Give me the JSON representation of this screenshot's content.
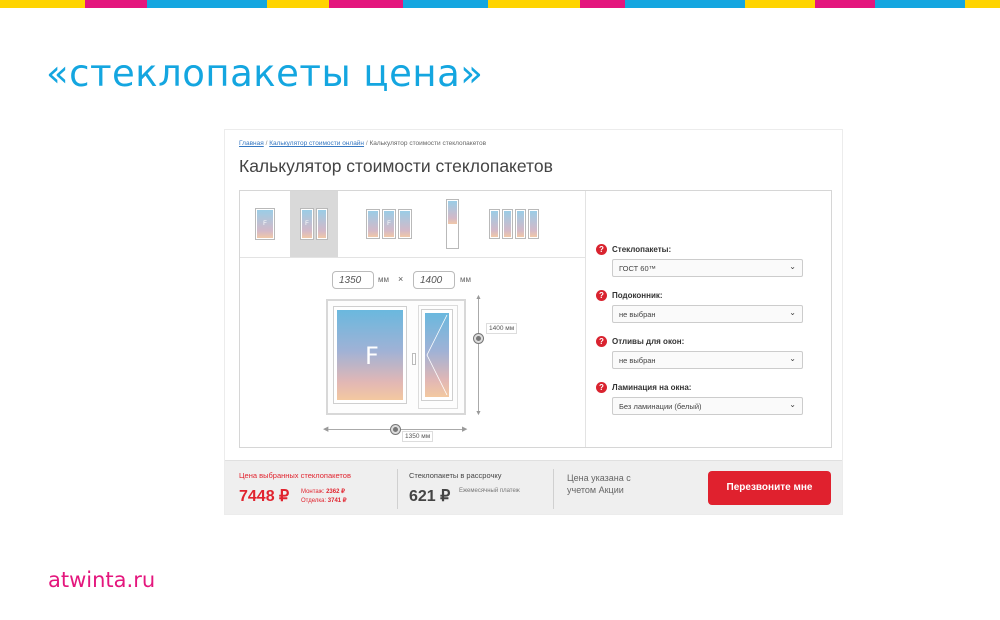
{
  "slide": {
    "title": "«стеклопакеты цена»",
    "site": "atwinta.ru",
    "stripe_colors": [
      "#ffd400",
      "#e4167d",
      "#14a6e0",
      "#ffd400",
      "#e4167d",
      "#14a6e0",
      "#ffd400",
      "#e4167d",
      "#14a6e0",
      "#ffd400",
      "#e4167d",
      "#14a6e0",
      "#ffd400",
      "#e4167d"
    ]
  },
  "breadcrumb": {
    "home": "Главная",
    "online_calc": "Калькулятор стоимости онлайн",
    "current": "Калькулятор стоимости стеклопакетов",
    "separator": "/"
  },
  "calculator": {
    "title": "Калькулятор стоимости стеклопакетов",
    "window_types": [
      "single",
      "double",
      "triple",
      "door",
      "quad"
    ],
    "active_type": "double",
    "width_value": "1350",
    "height_value": "1400",
    "unit": "мм",
    "times": "×",
    "glass_letter": "F",
    "width_label": "1350 мм",
    "height_label": "1400 мм"
  },
  "options": [
    {
      "label": "Стеклопакеты:",
      "value": "ГОСТ 60™"
    },
    {
      "label": "Подоконник:",
      "value": "не выбран"
    },
    {
      "label": "Отливы для окон:",
      "value": "не выбран"
    },
    {
      "label": "Ламинация на окна:",
      "value": "Без ламинации (белый)"
    }
  ],
  "price": {
    "caption": "Цена выбранных стеклопакетов",
    "total": "7448 ₽",
    "montage_label": "Монтаж:",
    "montage_value": "2362 ₽",
    "finishing_label": "Отделка:",
    "finishing_value": "3741 ₽"
  },
  "installment": {
    "caption": "Стеклопакеты в рассрочку",
    "value": "621 ₽",
    "note": "Ежемесячный платеж"
  },
  "promo_text": "Цена указана с учетом Акции",
  "cta_label": "Перезвоните мне",
  "colors": {
    "accent_red": "#e0212e",
    "title_blue": "#14a6e0",
    "site_pink": "#e4167d"
  }
}
